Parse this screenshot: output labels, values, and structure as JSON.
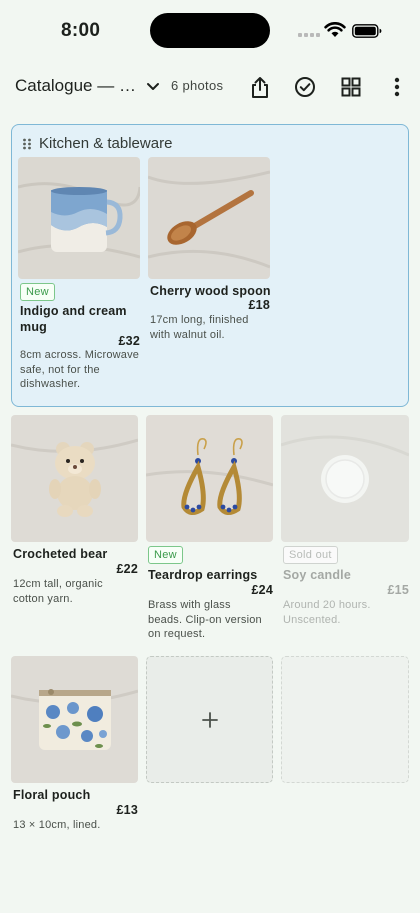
{
  "status": {
    "time": "8:00"
  },
  "appbar": {
    "title": "Catalogue — s...",
    "photo_count": "6 photos",
    "icons": [
      "chevron-down-icon",
      "share-icon",
      "check-circle-icon",
      "grid-view-icon",
      "more-vert-icon"
    ]
  },
  "section": {
    "title": "Kitchen & tableware",
    "items": [
      {
        "badge": "New",
        "name": "Indigo and cream mug",
        "price": "£32",
        "description": "8cm across. Microwave safe, not for the dishwasher."
      },
      {
        "name": "Cherry wood spoon",
        "price": "£18",
        "description": "17cm long, finished with walnut oil."
      }
    ]
  },
  "items": [
    {
      "name": "Crocheted bear",
      "price": "£22",
      "description": "12cm tall, organic cotton yarn."
    },
    {
      "badge": "New",
      "name": "Teardrop earrings",
      "price": "£24",
      "description": "Brass with glass beads. Clip-on version on request."
    },
    {
      "badge": "Sold out",
      "name": "Soy candle",
      "price": "£15",
      "description": "Around 20 hours. Unscented."
    },
    {
      "name": "Floral pouch",
      "price": "£13",
      "description": "13 × 10cm, lined."
    }
  ],
  "add_tile": {
    "icon": "plus-icon"
  },
  "colors": {
    "background": "#f2f7f2",
    "section_bg": "#e3f1f8",
    "section_border": "#7fb8d6",
    "new_badge": "#3a9a4a",
    "sold_badge": "#b8bcb8"
  }
}
